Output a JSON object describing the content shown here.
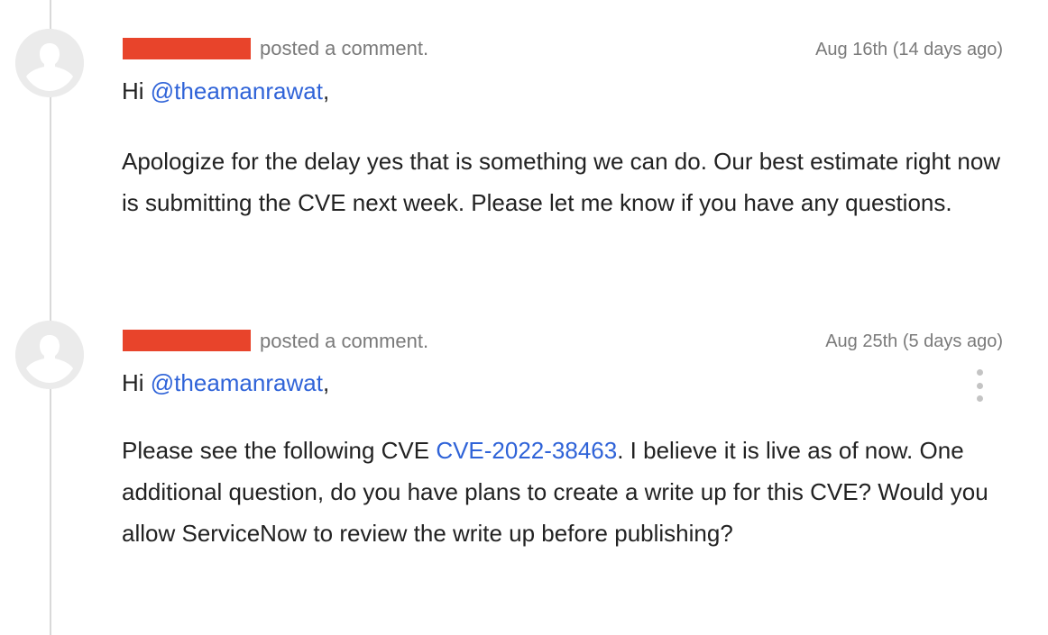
{
  "comments": [
    {
      "action": "posted a comment.",
      "timestamp": "Aug 16th (14 days ago)",
      "greeting_prefix": "Hi ",
      "mention": "@theamanrawat",
      "greeting_suffix": ",",
      "body": "Apologize for the delay yes that is something we can do. Our best estimate right now is submitting the CVE next week. Please let me know if you have any questions."
    },
    {
      "action": "posted a comment.",
      "timestamp": "Aug 25th (5 days ago)",
      "greeting_prefix": "Hi ",
      "mention": "@theamanrawat",
      "greeting_suffix": ",",
      "body_prefix": "Please see the following CVE ",
      "cve_link": "CVE-2022-38463",
      "body_suffix": ". I believe it is live as of now. One additional question, do you have plans to create a write up for this CVE? Would you allow ServiceNow to review the write up before publishing?"
    }
  ],
  "colors": {
    "redaction": "#e8442b",
    "link": "#2f63d8",
    "muted_text": "#7a7a7a",
    "timeline": "#d9d9d9",
    "avatar_bg": "#ebebeb"
  },
  "icons": {
    "avatar": "user-silhouette-icon",
    "menu": "kebab-menu-icon"
  }
}
